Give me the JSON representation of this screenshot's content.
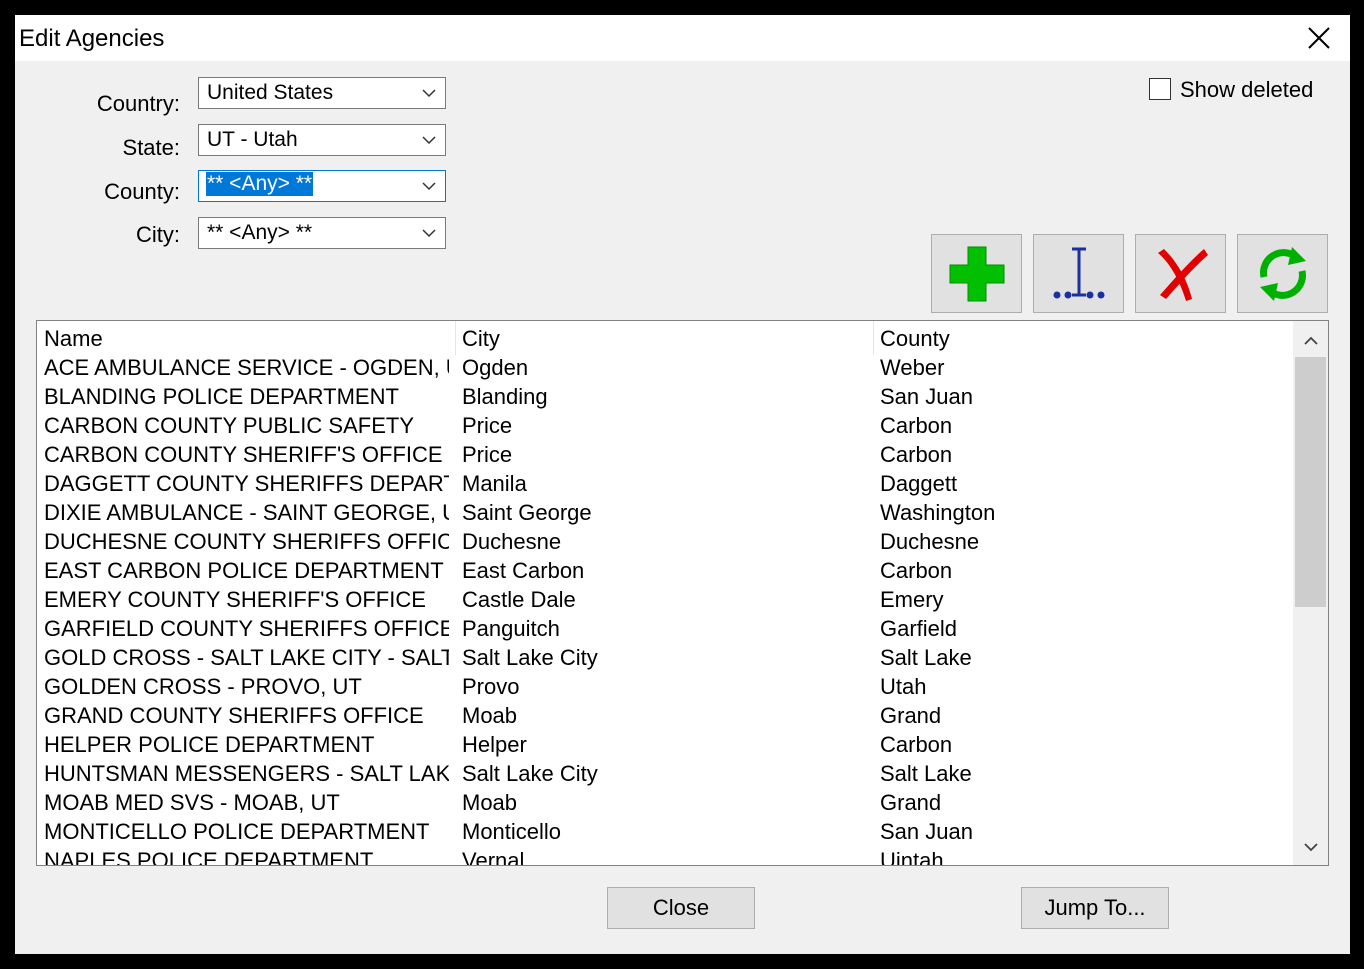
{
  "window": {
    "title": "Edit Agencies"
  },
  "filters": {
    "country_label": "Country:",
    "country_value": "United States",
    "state_label": "State:",
    "state_value": "UT - Utah",
    "county_label": "County:",
    "county_value": "** <Any> **",
    "city_label": "City:",
    "city_value": "** <Any> **"
  },
  "show_deleted": {
    "label": "Show deleted",
    "checked": false
  },
  "toolbar": {
    "add_icon": "green-plus-icon",
    "edit_icon": "text-cursor-icon",
    "delete_icon": "red-x-icon",
    "refresh_icon": "green-refresh-icon"
  },
  "table": {
    "columns": [
      "Name",
      "City",
      "County"
    ],
    "rows": [
      [
        "ACE AMBULANCE SERVICE - OGDEN, UT",
        "Ogden",
        "Weber"
      ],
      [
        "BLANDING POLICE DEPARTMENT",
        "Blanding",
        "San Juan"
      ],
      [
        "CARBON COUNTY PUBLIC SAFETY",
        "Price",
        "Carbon"
      ],
      [
        "CARBON COUNTY SHERIFF'S OFFICE",
        "Price",
        "Carbon"
      ],
      [
        "DAGGETT COUNTY SHERIFFS DEPARTME...",
        "Manila",
        "Daggett"
      ],
      [
        "DIXIE AMBULANCE - SAINT GEORGE, UT",
        "Saint George",
        "Washington"
      ],
      [
        "DUCHESNE COUNTY SHERIFFS OFFICE",
        "Duchesne",
        "Duchesne"
      ],
      [
        "EAST CARBON POLICE DEPARTMENT",
        "East Carbon",
        "Carbon"
      ],
      [
        "EMERY COUNTY SHERIFF'S OFFICE",
        "Castle Dale",
        "Emery"
      ],
      [
        "GARFIELD COUNTY SHERIFFS OFFICE",
        "Panguitch",
        "Garfield"
      ],
      [
        "GOLD CROSS - SALT LAKE CITY - SALT L...",
        "Salt Lake City",
        "Salt Lake"
      ],
      [
        "GOLDEN CROSS - PROVO, UT",
        "Provo",
        "Utah"
      ],
      [
        "GRAND COUNTY SHERIFFS OFFICE",
        "Moab",
        "Grand"
      ],
      [
        "HELPER POLICE DEPARTMENT",
        "Helper",
        "Carbon"
      ],
      [
        "HUNTSMAN MESSENGERS - SALT LAKE C...",
        "Salt Lake City",
        "Salt Lake"
      ],
      [
        "MOAB MED SVS - MOAB, UT",
        "Moab",
        "Grand"
      ],
      [
        "MONTICELLO POLICE DEPARTMENT",
        "Monticello",
        "San Juan"
      ],
      [
        "NAPLES POLICE DEPARTMENT",
        "Vernal",
        "Uintah"
      ]
    ]
  },
  "buttons": {
    "close": "Close",
    "jump_to": "Jump To..."
  }
}
